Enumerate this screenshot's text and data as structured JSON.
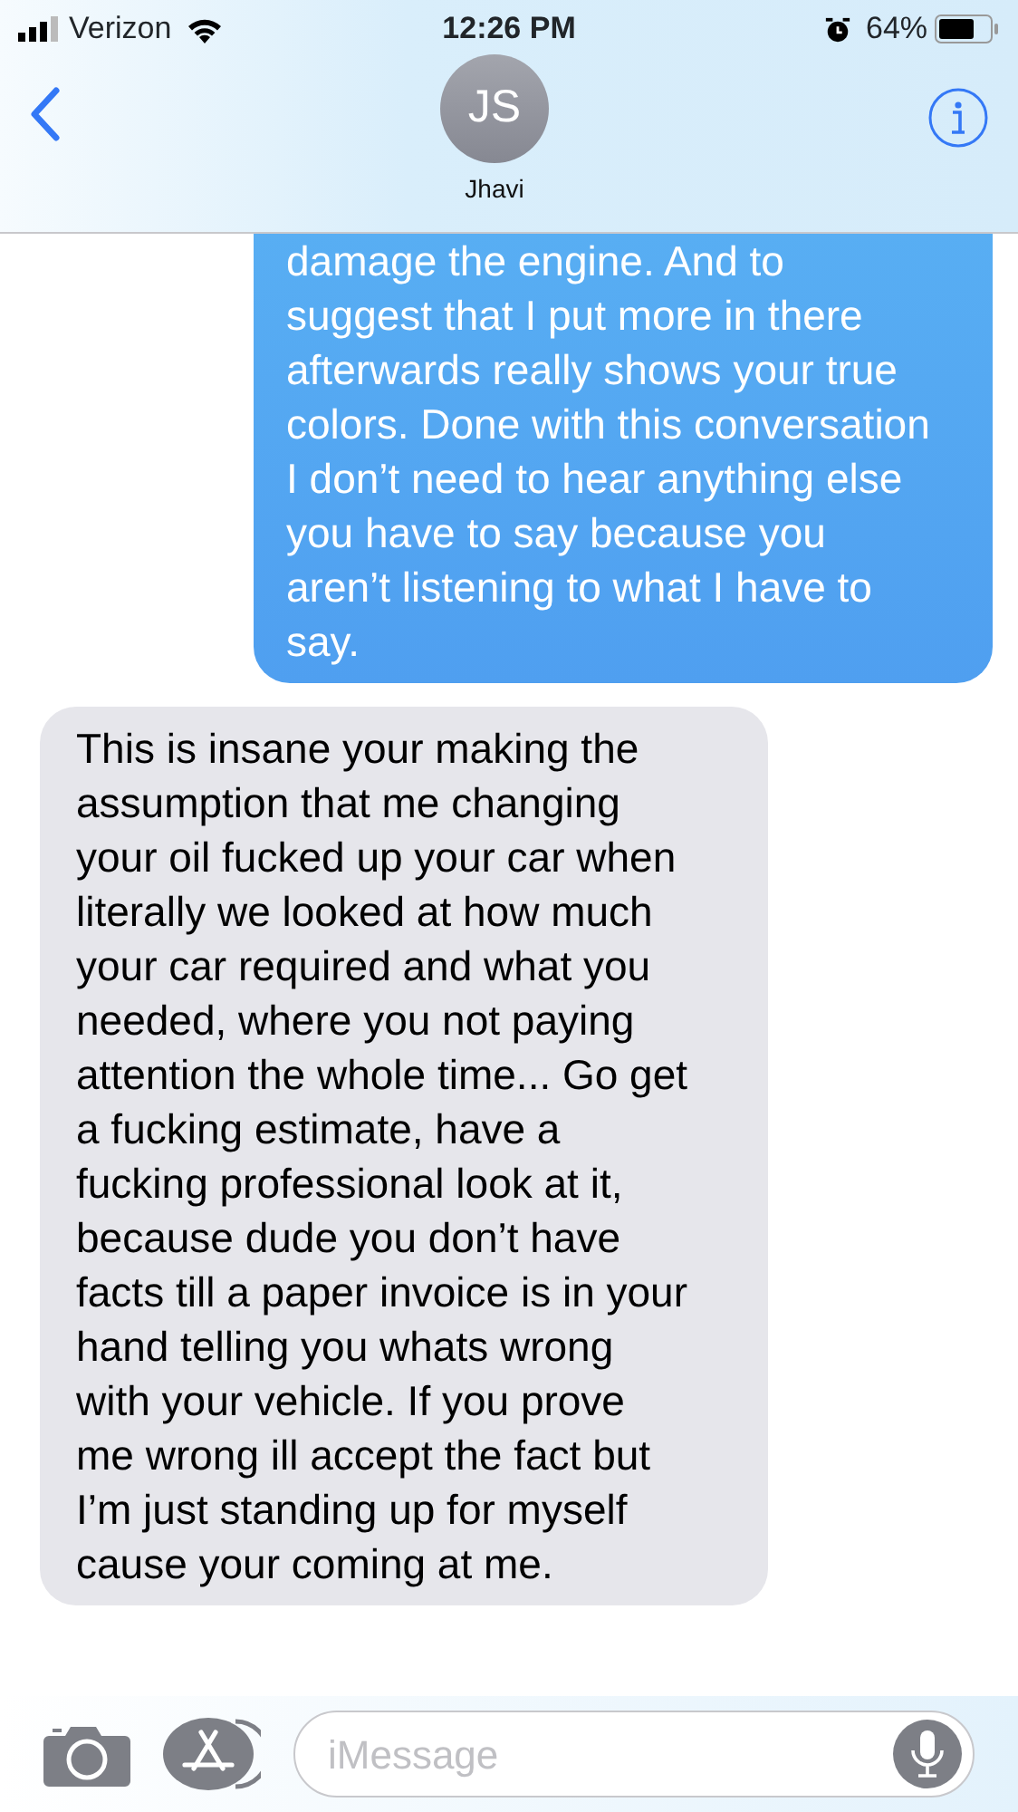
{
  "status_bar": {
    "carrier": "Verizon",
    "time": "12:26 PM",
    "battery": "64%"
  },
  "header": {
    "initials": "JS",
    "name": "Jhavi"
  },
  "messages": [
    {
      "kind": "sent",
      "text": "damage the engine. And to suggest that I put more in there afterwards really shows your true colors. Done with this conversation I don’t need to hear anything else you have to say because you aren’t listening to what I have to say."
    },
    {
      "kind": "received",
      "text": "This is insane your making the assumption that me changing your oil fucked up your car when literally we looked at how much your car required and what you needed, where you not paying attention the whole time... Go get a fucking estimate, have a fucking professional look at it, because dude you don’t have facts till a paper invoice is in your hand telling you whats wrong with your vehicle. If you prove me wrong ill accept the fact but I’m just standing up for myself cause your coming at me."
    }
  ],
  "composer": {
    "placeholder": "iMessage"
  }
}
